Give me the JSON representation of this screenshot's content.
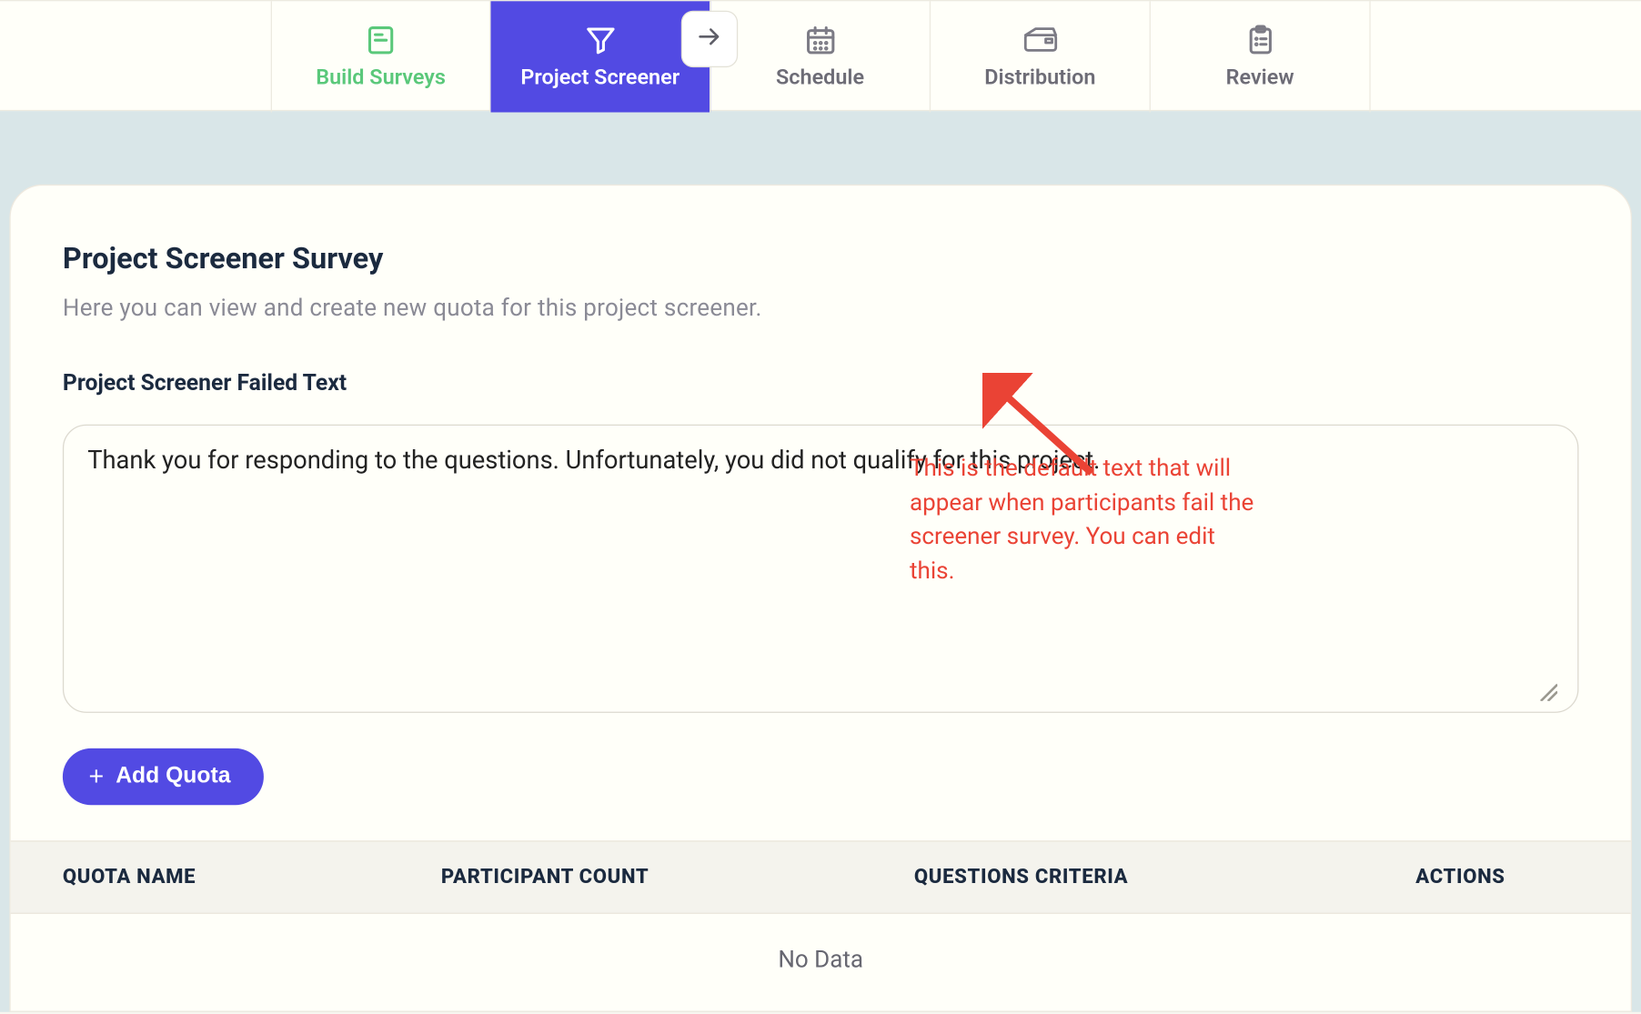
{
  "nav": {
    "tabs": [
      {
        "label": "Build Surveys",
        "icon": "doc",
        "active": false,
        "green": true
      },
      {
        "label": "Project Screener",
        "icon": "funnel",
        "active": true,
        "green": false
      },
      {
        "label": "Schedule",
        "icon": "calendar",
        "active": false,
        "green": false
      },
      {
        "label": "Distribution",
        "icon": "mailbox",
        "active": false,
        "green": false
      },
      {
        "label": "Review",
        "icon": "clipboard",
        "active": false,
        "green": false
      }
    ]
  },
  "page": {
    "title": "Project Screener Survey",
    "subtitle": "Here you can view and create new quota for this project screener.",
    "failed_section_title": "Project Screener Failed Text",
    "failed_text_value": "Thank you for responding to the questions. Unfortunately, you did not qualify for this project.",
    "add_quota_label": "Add Quota"
  },
  "table": {
    "headers": {
      "quota_name": "QUOTA NAME",
      "participant_count": "PARTICIPANT COUNT",
      "questions_criteria": "QUESTIONS CRITERIA",
      "actions": "ACTIONS"
    },
    "empty_text": "No Data",
    "rows": []
  },
  "annotation": {
    "text": "This is the default text that will appear when participants fail the screener survey. You can edit this."
  }
}
